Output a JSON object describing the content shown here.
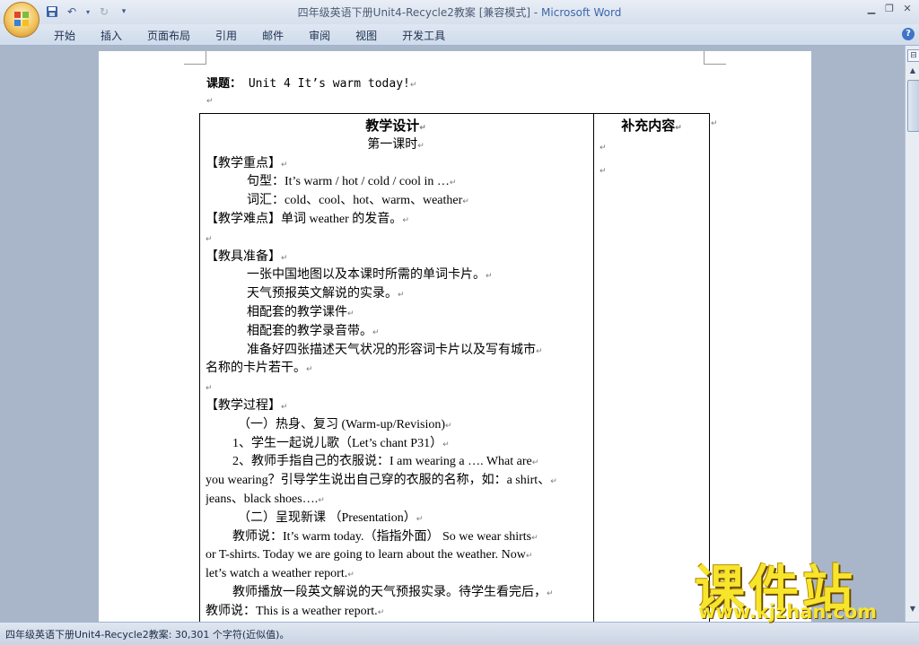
{
  "window": {
    "title_doc": "四年级英语下册Unit4-Recycle2教案 [兼容模式] - ",
    "title_app": "Microsoft Word",
    "min_icon": "minimize-icon",
    "restore_icon": "restore-icon",
    "close_icon": "close-icon"
  },
  "quick_access": {
    "save": "save-icon",
    "undo": "undo-icon",
    "redo": "redo-icon",
    "customize": "customize-icon"
  },
  "ribbon": {
    "tabs": [
      "开始",
      "插入",
      "页面布局",
      "引用",
      "邮件",
      "审阅",
      "视图",
      "开发工具"
    ],
    "help": "?"
  },
  "document": {
    "heading_label": "课题：",
    "heading_text": " Unit 4 It’s warm today!",
    "left_column": [
      {
        "text": "教学设计",
        "style": "title"
      },
      {
        "text": "第一课时",
        "style": "subtitle"
      },
      {
        "text": "【教学重点】",
        "style": "plain"
      },
      {
        "text": "句型：It’s warm / hot / cold / cool in …",
        "style": "ind1"
      },
      {
        "text": "词汇：cold、cool、hot、warm、weather",
        "style": "ind1"
      },
      {
        "text": "【教学难点】单词 weather 的发音。",
        "style": "plain"
      },
      {
        "text": "",
        "style": "plain"
      },
      {
        "text": "【教具准备】",
        "style": "plain"
      },
      {
        "text": "一张中国地图以及本课时所需的单词卡片。",
        "style": "ind1"
      },
      {
        "text": "天气预报英文解说的实录。",
        "style": "ind1"
      },
      {
        "text": "相配套的教学课件",
        "style": "ind1"
      },
      {
        "text": "相配套的教学录音带。",
        "style": "ind1"
      },
      {
        "text": "准备好四张描述天气状况的形容词卡片以及写有城市",
        "style": "ind1"
      },
      {
        "text": "名称的卡片若干。",
        "style": "plain"
      },
      {
        "text": "",
        "style": "plain"
      },
      {
        "text": "【教学过程】",
        "style": "plain"
      },
      {
        "text": "（一）热身、复习 (Warm-up/Revision)",
        "style": "ind3"
      },
      {
        "text": "1、学生一起说儿歌（Let’s chant P31）",
        "style": "ind2"
      },
      {
        "text": "2、教师手指自己的衣服说：I am wearing a …. What are",
        "style": "ind2"
      },
      {
        "text": "you wearing？引导学生说出自己穿的衣服的名称，如：a shirt、",
        "style": "plain"
      },
      {
        "text": "jeans、black shoes….",
        "style": "plain"
      },
      {
        "text": "（二）呈现新课 （Presentation）",
        "style": "ind3"
      },
      {
        "text": "教师说：It’s warm today.（指指外面） So we wear shirts",
        "style": "ind2"
      },
      {
        "text": "or T-shirts. Today we are going to learn about the weather. Now",
        "style": "plain"
      },
      {
        "text": "let’s watch a weather report.",
        "style": "plain"
      },
      {
        "text": "教师播放一段英文解说的天气预报实录。待学生看完后，",
        "style": "ind2"
      },
      {
        "text": "教师说：This is a weather report.",
        "style": "plain"
      }
    ],
    "right_header": "补充内容",
    "paragraph_mark": "↵"
  },
  "statusbar": {
    "text": "四年级英语下册Unit4-Recycle2教案: 30,301 个字符(近似值)。"
  },
  "watermark": {
    "big": "课件站",
    "url": "www.kjzhan.com"
  }
}
